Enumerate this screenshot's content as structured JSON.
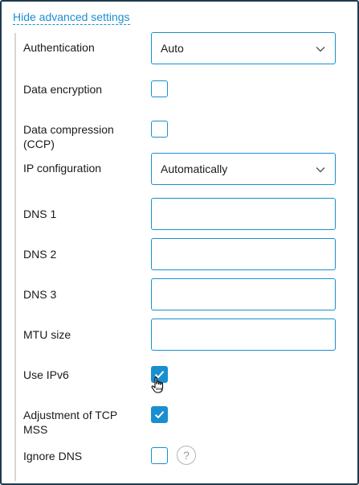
{
  "toggle_link": "Hide advanced settings",
  "fields": {
    "authentication": {
      "label": "Authentication",
      "value": "Auto"
    },
    "data_encryption": {
      "label": "Data encryption",
      "checked": false
    },
    "data_compression": {
      "label": "Data compression\n(CCP)",
      "checked": false
    },
    "ip_configuration": {
      "label": "IP configuration",
      "value": "Automatically"
    },
    "dns1": {
      "label": "DNS 1",
      "value": ""
    },
    "dns2": {
      "label": "DNS 2",
      "value": ""
    },
    "dns3": {
      "label": "DNS 3",
      "value": ""
    },
    "mtu_size": {
      "label": "MTU size",
      "value": ""
    },
    "use_ipv6": {
      "label": "Use IPv6",
      "checked": true
    },
    "tcp_mss": {
      "label": "Adjustment of TCP\nMSS",
      "checked": true
    },
    "ignore_dns": {
      "label": "Ignore DNS",
      "checked": false,
      "help": "?"
    }
  },
  "colors": {
    "accent": "#1a8fd0",
    "frame": "#1f3a4d",
    "rail": "#d6d6d6"
  },
  "icons": {
    "select": "chevron-down-icon",
    "check": "checkmark-icon",
    "help": "question-icon",
    "cursor": "hand-pointer-icon"
  }
}
